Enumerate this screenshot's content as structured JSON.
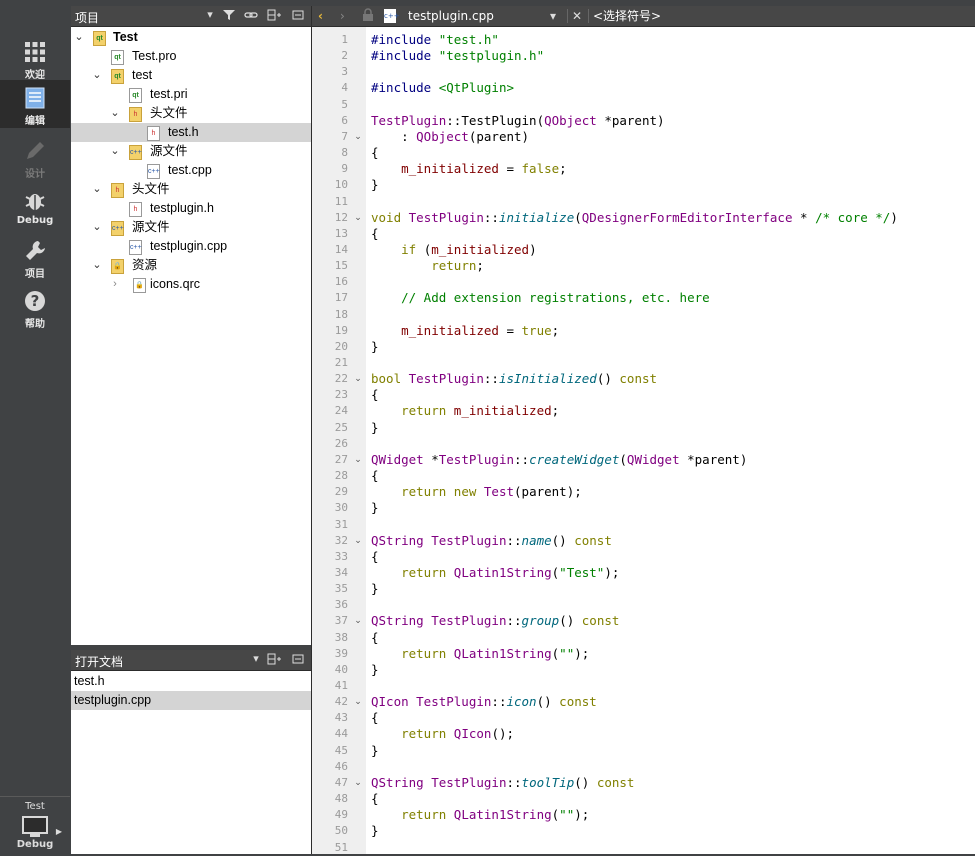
{
  "modebar": {
    "items": [
      {
        "label": "欢迎",
        "icon": "grid-icon"
      },
      {
        "label": "编辑",
        "icon": "document-icon"
      },
      {
        "label": "设计",
        "icon": "pencil-icon"
      },
      {
        "label": "Debug",
        "icon": "bug-icon"
      },
      {
        "label": "项目",
        "icon": "wrench-icon"
      },
      {
        "label": "帮助",
        "icon": "help-icon"
      }
    ],
    "kit_project": "Test",
    "kit_config": "Debug"
  },
  "projects_pane": {
    "title": "项目",
    "tree": [
      {
        "label": "Test",
        "depth": 0,
        "expanded": true,
        "kind": "project",
        "bold": true
      },
      {
        "label": "Test.pro",
        "depth": 1,
        "kind": "pro"
      },
      {
        "label": "test",
        "depth": 1,
        "expanded": true,
        "kind": "folder"
      },
      {
        "label": "test.pri",
        "depth": 2,
        "kind": "pro"
      },
      {
        "label": "头文件",
        "depth": 2,
        "expanded": true,
        "kind": "hfolder"
      },
      {
        "label": "test.h",
        "depth": 3,
        "kind": "h",
        "selected": true
      },
      {
        "label": "源文件",
        "depth": 2,
        "expanded": true,
        "kind": "cppfolder"
      },
      {
        "label": "test.cpp",
        "depth": 3,
        "kind": "cpp"
      },
      {
        "label": "头文件",
        "depth": 1,
        "expanded": true,
        "kind": "hfolder"
      },
      {
        "label": "testplugin.h",
        "depth": 2,
        "kind": "h"
      },
      {
        "label": "源文件",
        "depth": 1,
        "expanded": true,
        "kind": "cppfolder"
      },
      {
        "label": "testplugin.cpp",
        "depth": 2,
        "kind": "cpp"
      },
      {
        "label": "资源",
        "depth": 1,
        "expanded": true,
        "kind": "resfolder"
      },
      {
        "label": "icons.qrc",
        "depth": 2,
        "expanded": false,
        "kind": "qrc"
      }
    ]
  },
  "open_docs": {
    "title": "打开文档",
    "items": [
      {
        "label": "test.h",
        "selected": false
      },
      {
        "label": "testplugin.cpp",
        "selected": true
      }
    ]
  },
  "editor": {
    "file_name": "testplugin.cpp",
    "symbol_placeholder": "<选择符号>",
    "lines": [
      [
        [
          "pp",
          "#include "
        ],
        [
          "str",
          "\"test.h\""
        ]
      ],
      [
        [
          "pp",
          "#include "
        ],
        [
          "str",
          "\"testplugin.h\""
        ]
      ],
      [],
      [
        [
          "pp",
          "#include "
        ],
        [
          "str",
          "<QtPlugin>"
        ]
      ],
      [],
      [
        [
          "ty",
          "TestPlugin"
        ],
        [
          "",
          "::TestPlugin("
        ],
        [
          "ty",
          "QObject"
        ],
        [
          "",
          " *parent)"
        ]
      ],
      [
        [
          "",
          "    : "
        ],
        [
          "ty",
          "QObject"
        ],
        [
          "",
          "(parent)"
        ]
      ],
      [
        [
          "",
          "{"
        ]
      ],
      [
        [
          "",
          "    "
        ],
        [
          "mem",
          "m_initialized"
        ],
        [
          "",
          " = "
        ],
        [
          "kw",
          "false"
        ],
        [
          "",
          ";"
        ]
      ],
      [
        [
          "",
          "}"
        ]
      ],
      [],
      [
        [
          "kw",
          "void "
        ],
        [
          "ty",
          "TestPlugin"
        ],
        [
          "",
          "::"
        ],
        [
          "fn",
          "initialize"
        ],
        [
          "",
          "("
        ],
        [
          "ty",
          "QDesignerFormEditorInterface"
        ],
        [
          "",
          " * "
        ],
        [
          "cm",
          "/* core */"
        ],
        [
          "",
          ")"
        ]
      ],
      [
        [
          "",
          "{"
        ]
      ],
      [
        [
          "",
          "    "
        ],
        [
          "kw",
          "if"
        ],
        [
          "",
          " ("
        ],
        [
          "mem",
          "m_initialized"
        ],
        [
          "",
          ")"
        ]
      ],
      [
        [
          "",
          "        "
        ],
        [
          "kw",
          "return"
        ],
        [
          "",
          ";"
        ]
      ],
      [],
      [
        [
          "",
          "    "
        ],
        [
          "cm",
          "// Add extension registrations, etc. here"
        ]
      ],
      [],
      [
        [
          "",
          "    "
        ],
        [
          "mem",
          "m_initialized"
        ],
        [
          "",
          " = "
        ],
        [
          "kw",
          "true"
        ],
        [
          "",
          ";"
        ]
      ],
      [
        [
          "",
          "}"
        ]
      ],
      [],
      [
        [
          "kw",
          "bool "
        ],
        [
          "ty",
          "TestPlugin"
        ],
        [
          "",
          "::"
        ],
        [
          "fn",
          "isInitialized"
        ],
        [
          "",
          "() "
        ],
        [
          "kw",
          "const"
        ]
      ],
      [
        [
          "",
          "{"
        ]
      ],
      [
        [
          "",
          "    "
        ],
        [
          "kw",
          "return "
        ],
        [
          "mem",
          "m_initialized"
        ],
        [
          "",
          ";"
        ]
      ],
      [
        [
          "",
          "}"
        ]
      ],
      [],
      [
        [
          "ty",
          "QWidget"
        ],
        [
          "",
          " *"
        ],
        [
          "ty",
          "TestPlugin"
        ],
        [
          "",
          "::"
        ],
        [
          "fn",
          "createWidget"
        ],
        [
          "",
          "("
        ],
        [
          "ty",
          "QWidget"
        ],
        [
          "",
          " *parent)"
        ]
      ],
      [
        [
          "",
          "{"
        ]
      ],
      [
        [
          "",
          "    "
        ],
        [
          "kw",
          "return new "
        ],
        [
          "ty",
          "Test"
        ],
        [
          "",
          "(parent);"
        ]
      ],
      [
        [
          "",
          "}"
        ]
      ],
      [],
      [
        [
          "ty",
          "QString "
        ],
        [
          "ty",
          "TestPlugin"
        ],
        [
          "",
          "::"
        ],
        [
          "fn",
          "name"
        ],
        [
          "",
          "() "
        ],
        [
          "kw",
          "const"
        ]
      ],
      [
        [
          "",
          "{"
        ]
      ],
      [
        [
          "",
          "    "
        ],
        [
          "kw",
          "return "
        ],
        [
          "ty",
          "QLatin1String"
        ],
        [
          "",
          "("
        ],
        [
          "str",
          "\"Test\""
        ],
        [
          "",
          ");"
        ]
      ],
      [
        [
          "",
          "}"
        ]
      ],
      [],
      [
        [
          "ty",
          "QString "
        ],
        [
          "ty",
          "TestPlugin"
        ],
        [
          "",
          "::"
        ],
        [
          "fn",
          "group"
        ],
        [
          "",
          "() "
        ],
        [
          "kw",
          "const"
        ]
      ],
      [
        [
          "",
          "{"
        ]
      ],
      [
        [
          "",
          "    "
        ],
        [
          "kw",
          "return "
        ],
        [
          "ty",
          "QLatin1String"
        ],
        [
          "",
          "("
        ],
        [
          "str",
          "\"\""
        ],
        [
          "",
          ");"
        ]
      ],
      [
        [
          "",
          "}"
        ]
      ],
      [],
      [
        [
          "ty",
          "QIcon "
        ],
        [
          "ty",
          "TestPlugin"
        ],
        [
          "",
          "::"
        ],
        [
          "fn",
          "icon"
        ],
        [
          "",
          "() "
        ],
        [
          "kw",
          "const"
        ]
      ],
      [
        [
          "",
          "{"
        ]
      ],
      [
        [
          "",
          "    "
        ],
        [
          "kw",
          "return "
        ],
        [
          "ty",
          "QIcon"
        ],
        [
          "",
          "();"
        ]
      ],
      [
        [
          "",
          "}"
        ]
      ],
      [],
      [
        [
          "ty",
          "QString "
        ],
        [
          "ty",
          "TestPlugin"
        ],
        [
          "",
          "::"
        ],
        [
          "fn",
          "toolTip"
        ],
        [
          "",
          "() "
        ],
        [
          "kw",
          "const"
        ]
      ],
      [
        [
          "",
          "{"
        ]
      ],
      [
        [
          "",
          "    "
        ],
        [
          "kw",
          "return "
        ],
        [
          "ty",
          "QLatin1String"
        ],
        [
          "",
          "("
        ],
        [
          "str",
          "\"\""
        ],
        [
          "",
          ");"
        ]
      ],
      [
        [
          "",
          "}"
        ]
      ],
      []
    ],
    "fold_lines": [
      7,
      12,
      22,
      27,
      32,
      37,
      42,
      47
    ]
  }
}
